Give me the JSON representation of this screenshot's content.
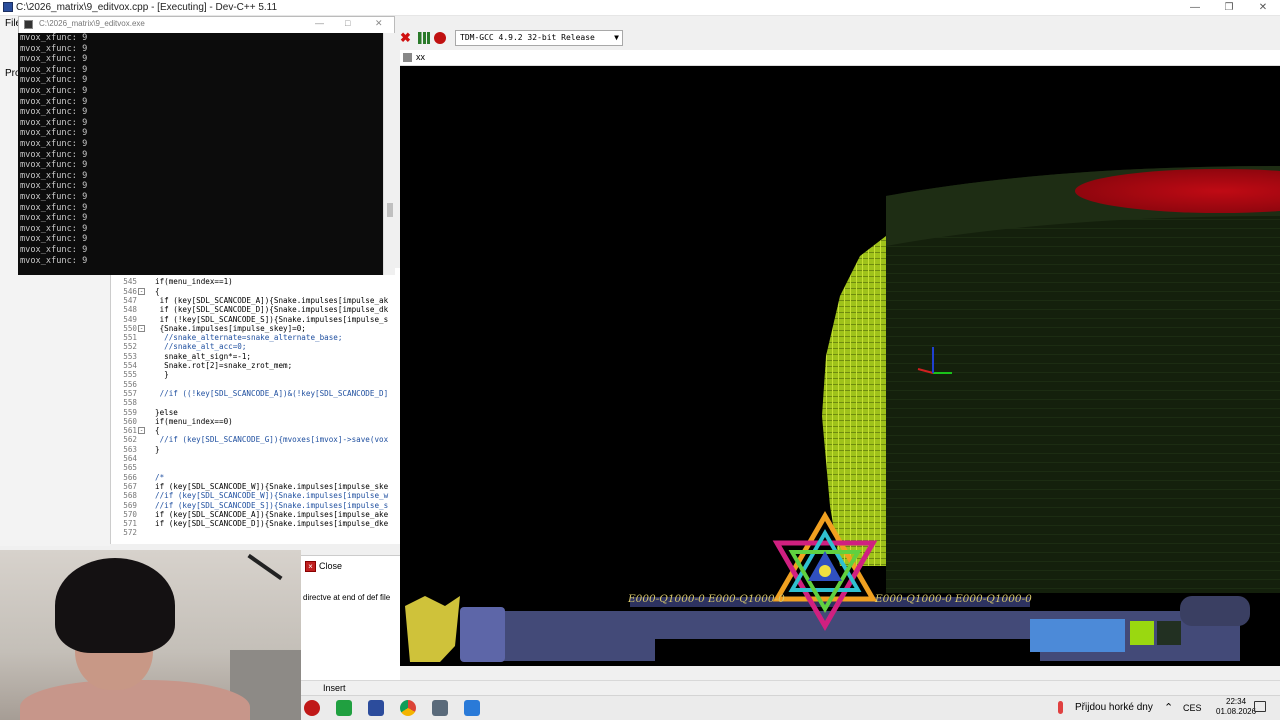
{
  "ide": {
    "title": "C:\\2026_matrix\\9_editvox.cpp - [Executing] - Dev-C++ 5.11",
    "menu_file": "File",
    "project_tab": "Pro",
    "compiler": "TDM-GCC 4.9.2 32-bit Release",
    "mode": "Insert"
  },
  "console": {
    "title": "C:\\2026_matrix\\9_editvox.exe",
    "lines": [
      "mvox_xfunc: 9",
      "mvox_xfunc: 9",
      "mvox_xfunc: 9",
      "mvox_xfunc: 9",
      "mvox_xfunc: 9",
      "mvox_xfunc: 9",
      "mvox_xfunc: 9",
      "mvox_xfunc: 9",
      "mvox_xfunc: 9",
      "mvox_xfunc: 9",
      "mvox_xfunc: 9",
      "mvox_xfunc: 9",
      "mvox_xfunc: 9",
      "mvox_xfunc: 9",
      "mvox_xfunc: 9",
      "mvox_xfunc: 9",
      "mvox_xfunc: 9",
      "mvox_xfunc: 9",
      "mvox_xfunc: 9",
      "mvox_xfunc: 9",
      "mvox_xfunc: 9",
      "mvox_xfunc: 9"
    ]
  },
  "editor": {
    "lines": [
      {
        "n": "544",
        "code": "",
        "fold": ""
      },
      {
        "n": "545",
        "code": "if(menu_index==1)",
        "fold": ""
      },
      {
        "n": "546",
        "code": "{",
        "fold": "-"
      },
      {
        "n": "547",
        "code": " if (key[SDL_SCANCODE_A]){Snake.impulses[impulse_ak",
        "fold": ""
      },
      {
        "n": "548",
        "code": " if (key[SDL_SCANCODE_D]){Snake.impulses[impulse_dk",
        "fold": ""
      },
      {
        "n": "549",
        "code": " if (!key[SDL_SCANCODE_S]){Snake.impulses[impulse_s",
        "fold": ""
      },
      {
        "n": "550",
        "code": " {Snake.impulses[impulse_skey]=0;",
        "fold": "-"
      },
      {
        "n": "551",
        "code": "  //snake_alternate=snake_alternate_base;",
        "fold": ""
      },
      {
        "n": "552",
        "code": "  //snake_alt_acc=0;",
        "fold": ""
      },
      {
        "n": "553",
        "code": "  snake_alt_sign*=-1;",
        "fold": ""
      },
      {
        "n": "554",
        "code": "  Snake.rot[2]=snake_zrot_mem;",
        "fold": ""
      },
      {
        "n": "555",
        "code": "  }",
        "fold": ""
      },
      {
        "n": "556",
        "code": "",
        "fold": ""
      },
      {
        "n": "557",
        "code": " //if ((!key[SDL_SCANCODE_A])&(!key[SDL_SCANCODE_D]",
        "fold": ""
      },
      {
        "n": "558",
        "code": "",
        "fold": ""
      },
      {
        "n": "559",
        "code": "}else",
        "fold": ""
      },
      {
        "n": "560",
        "code": "if(menu_index==0)",
        "fold": ""
      },
      {
        "n": "561",
        "code": "{",
        "fold": "-"
      },
      {
        "n": "562",
        "code": " //if (key[SDL_SCANCODE_G]){mvoxes[imvox]->save(vox",
        "fold": ""
      },
      {
        "n": "563",
        "code": "}",
        "fold": ""
      },
      {
        "n": "564",
        "code": "",
        "fold": ""
      },
      {
        "n": "565",
        "code": "",
        "fold": ""
      },
      {
        "n": "566",
        "code": "/*",
        "fold": ""
      },
      {
        "n": "567",
        "code": "if (key[SDL_SCANCODE_W]){Snake.impulses[impulse_ske",
        "fold": ""
      },
      {
        "n": "568",
        "code": "//if (key[SDL_SCANCODE_W]){Snake.impulses[impulse_w",
        "fold": ""
      },
      {
        "n": "569",
        "code": "//if (key[SDL_SCANCODE_S]){Snake.impulses[impulse_s",
        "fold": ""
      },
      {
        "n": "570",
        "code": "if (key[SDL_SCANCODE_A]){Snake.impulses[impulse_ake",
        "fold": ""
      },
      {
        "n": "571",
        "code": "if (key[SDL_SCANCODE_D]){Snake.impulses[impulse_dke",
        "fold": ""
      },
      {
        "n": "572",
        "code": "",
        "fold": ""
      }
    ]
  },
  "log": {
    "close_label": "Close",
    "message": "directve at end of def file"
  },
  "game": {
    "title": "xx",
    "hud_labels": [
      "E000-Q1000-0",
      "E000-Q1000-0",
      "E000-Q1000-0",
      "E000-Q1000-0"
    ]
  },
  "taskbar": {
    "weather": "Přijdou horké dny",
    "lang": "CES",
    "time": "22:34",
    "date": "01.08.2026"
  },
  "colors": {
    "voxel_green": "#9fc21a",
    "wall_dark": "#14200c",
    "red_disc": "#b00812",
    "hud_panel": "#434a78",
    "hud_gold": "#d8c86a"
  }
}
